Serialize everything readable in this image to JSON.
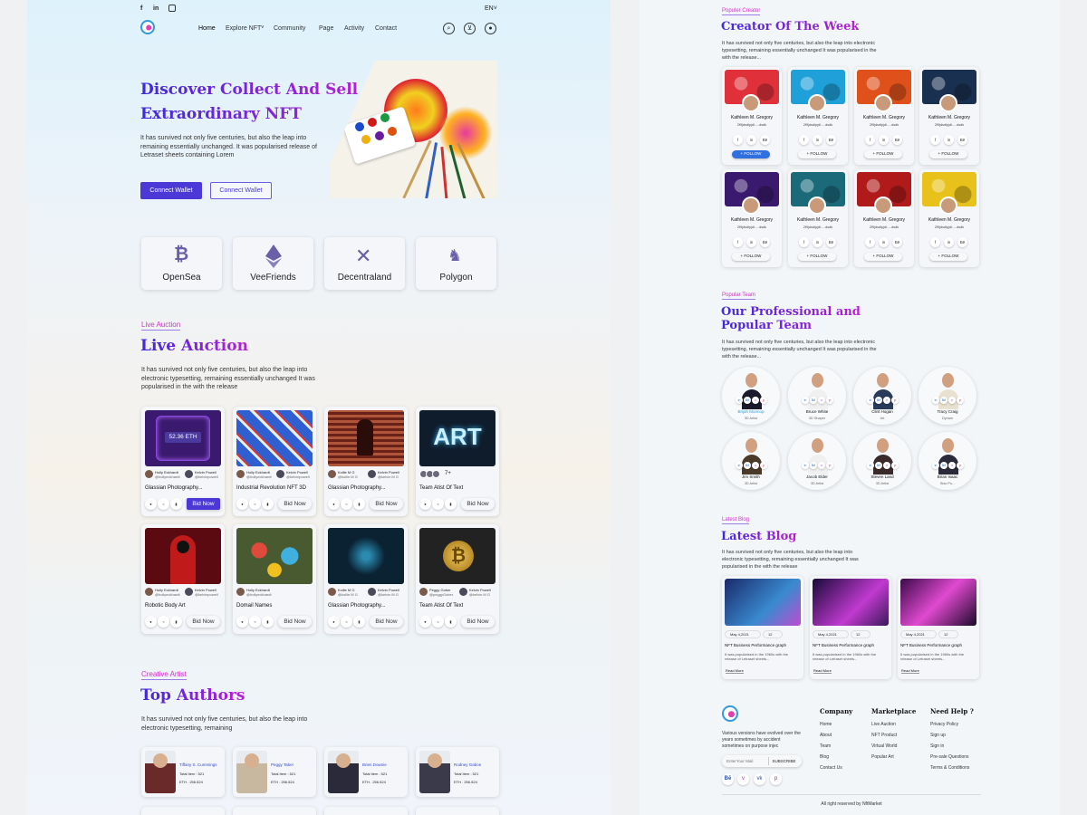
{
  "header": {
    "lang": "EN",
    "nav": [
      "Home",
      "Explore NFT",
      "Community",
      "Page",
      "Activity",
      "Contact"
    ],
    "social": [
      "f",
      "in",
      "ig"
    ]
  },
  "hero": {
    "title_line1": "Discover Collect And Sell",
    "title_line2": "Extraordinary NFT",
    "desc": "It has survived not only five centuries, but also the leap into remaining essentially unchanged. It was popularised release of Letraset sheets containing Lorem",
    "btn_primary": "Connect Wallet",
    "btn_secondary": "Connect Wallet"
  },
  "partners": [
    {
      "name": "OpenSea",
      "icon": "bitcoin-icon"
    },
    {
      "name": "VeeFriends",
      "icon": "ethereum-icon"
    },
    {
      "name": "Decentraland",
      "icon": "x-icon"
    },
    {
      "name": "Polygon",
      "icon": "unicorn-icon"
    }
  ],
  "auction": {
    "tag": "Live Auction",
    "title": "Live Auction",
    "desc": "It has survived not only five centuries, but also the leap into electronic typesetting, remaining essentially unchanged It was popularised in the with the release",
    "items": [
      {
        "title": "Glassian Photography...",
        "creator": "Holly Eckhardt",
        "creator_handle": "@hollyeckhardt",
        "owner": "Kelvin Powell",
        "owner_handle": "@kelvinpowell",
        "button": "Bid Now",
        "price": "52.36 ETH",
        "color": "#3a1a6e"
      },
      {
        "title": "Industrial Revolution NFT 3D",
        "creator": "Holly Eckhardt",
        "creator_handle": "@hollyeckhardt",
        "owner": "Kelvin Powell",
        "owner_handle": "@kelvinpowell",
        "button": "Bid Now",
        "color": "#3f6fd6"
      },
      {
        "title": "Glassian Photography...",
        "creator": "Kollie M G",
        "creator_handle": "@kollie M G",
        "owner": "Kelvin Powell",
        "owner_handle": "@kelvin M G",
        "button": "Bid Now",
        "color": "#7a2e28"
      },
      {
        "title": "Team Atist Of Text",
        "creator": "",
        "creator_handle": "",
        "owner": "7+",
        "owner_handle": "",
        "button": "Bid Now",
        "color": "#0f1c2c",
        "art": "ART"
      },
      {
        "title": "Robotic Body Art",
        "creator": "Holly Eckhardt",
        "creator_handle": "@hollyeckhardt",
        "owner": "Kelvin Powell",
        "owner_handle": "@kelvinpowell",
        "button": "Bid Now",
        "color": "#5a0a10"
      },
      {
        "title": "Domail Names",
        "creator": "Holly Eckhardt",
        "creator_handle": "@hollyeckhardt",
        "owner": "",
        "owner_handle": "",
        "button": "Bid Now",
        "color": "#3e4c2a"
      },
      {
        "title": "Glassian Photography...",
        "creator": "Kollie M G",
        "creator_handle": "@kollie M G",
        "owner": "Kelvin Powell",
        "owner_handle": "@kelvin M G",
        "button": "Bid Now",
        "color": "#0b2233"
      },
      {
        "title": "Team Atist Of Text",
        "creator": "Peggy Gober",
        "creator_handle": "@peggyGober",
        "owner": "Kelvin Powell",
        "owner_handle": "@kelvin M G",
        "button": "Bid Now",
        "color": "#222"
      }
    ]
  },
  "authors": {
    "tag": "Creative Artist",
    "title": "Top Authors",
    "desc": "It has survived not only five centuries, but also the leap into electronic typesetting, remaining",
    "items": [
      {
        "name": "Tiffany S. Cummings",
        "items": "Total Item : 521",
        "eth": "ETH . 256.524"
      },
      {
        "name": "Peggy Taber",
        "items": "Total Item : 521",
        "eth": "ETH . 256.524"
      },
      {
        "name": "Brien Downie",
        "items": "Total Item : 521",
        "eth": "ETH . 256.524"
      },
      {
        "name": "Rodney Gabon",
        "items": "Total Item : 521",
        "eth": "ETH . 256.524"
      }
    ]
  },
  "creators": {
    "tag": "Populer Creator",
    "title": "Creator Of The Week",
    "desc": "It has survived not only five centuries, but also the leap into electronic typesetting, remaining essentially unchanged It was popularised in the with the release...",
    "name": "Kathleen M. Gregory",
    "handle": "2f9jdsdlpjdl.....dsdk",
    "follow": "+ FOLLOW",
    "colors": [
      "#e0303a",
      "#1fa0d8",
      "#e0501a",
      "#1a3050",
      "#3a1a6e",
      "#1a6a7a",
      "#b01a1a",
      "#e8c21a"
    ]
  },
  "team": {
    "tag": "Popular Team",
    "title_line1": "Our Professional and",
    "title_line2": "Popular Team",
    "desc": "It has survived not only five centuries, but also the leap into electronic typesetting, remaining essentially unchanged It was popularised in the with the release...",
    "members": [
      {
        "name": "Brijah Monnop",
        "role": "3D Artist"
      },
      {
        "name": "Bruce White",
        "role": "3D Shaper"
      },
      {
        "name": "Clint Hogan",
        "role": "Art"
      },
      {
        "name": "Tracy Craig",
        "role": "Dynam"
      },
      {
        "name": "Jim Smith",
        "role": "3D Artist"
      },
      {
        "name": "Jacob Elder",
        "role": "3D Artist"
      },
      {
        "name": "Steven Land",
        "role": "3D Artist"
      },
      {
        "name": "Brian Isaac",
        "role": "Stac Pu..."
      }
    ]
  },
  "blog": {
    "tag": "Latest Blog",
    "title": "Latest Blog",
    "desc": "It has survived not only five centuries, but also the leap into electronic typesetting, remaining essentially unchanged It was popularised in the with the release",
    "date": "May 4,2021",
    "comments": "12",
    "post_title": "NFT Business Performance graph",
    "post_desc": "It was popularised in the 1960s with the release of Letraset sheets...",
    "read": "Read More"
  },
  "footer": {
    "about": "Various versions have evolved over the years sometimes by accident sometimes on purpose injec",
    "email_placeholder": "EnterYour Mail",
    "subscribe": "SUBSCRIBE",
    "company": {
      "title": "Company",
      "links": [
        "Home",
        "About",
        "Team",
        "Blog",
        "Contact Us"
      ]
    },
    "marketplace": {
      "title": "Marketplace",
      "links": [
        "Live Auction",
        "NFT Product",
        "Virtual World",
        "Popular Art"
      ]
    },
    "help": {
      "title": "Need Help ?",
      "links": [
        "Privacy Policy",
        "Sign up",
        "Sign in",
        "Pre-sale Questions",
        "Terms & Conditions"
      ]
    },
    "copyright": "All right reserved by NftMarket"
  },
  "colors": {
    "accent": "#4b38d6",
    "pink": "#d52fcd",
    "blue": "#2f6fe0"
  }
}
